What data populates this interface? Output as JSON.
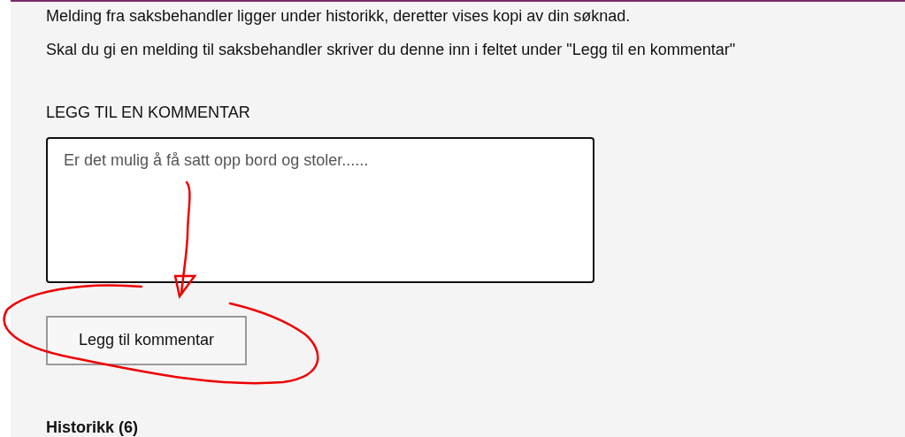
{
  "intro": [
    "Melding fra saksbehandler ligger under historikk, deretter vises kopi av din søknad.",
    "Skal du gi en melding til saksbehandler skriver du denne inn i feltet under \"Legg til en kommentar\""
  ],
  "comment": {
    "heading": "LEGG TIL EN KOMMENTAR",
    "value": "Er det mulig å få satt opp bord og stoler......",
    "button": "Legg til kommentar"
  },
  "history": {
    "title": "Historikk (6)"
  }
}
